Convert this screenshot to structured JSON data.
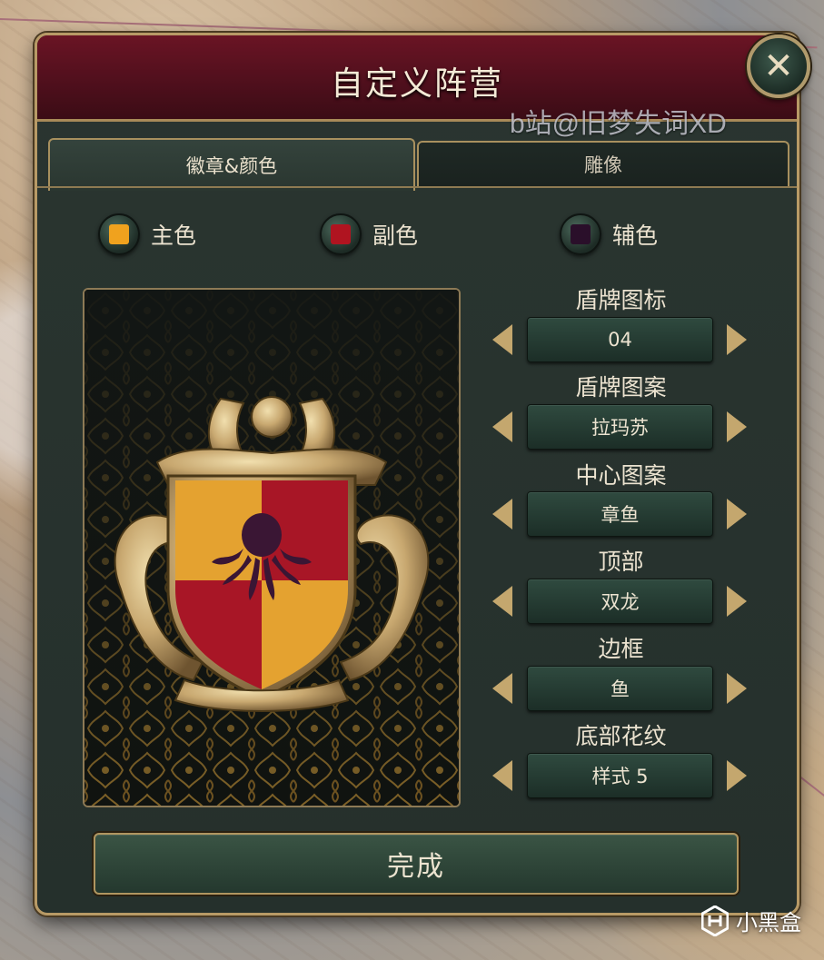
{
  "window": {
    "title": "自定义阵营",
    "close_symbol": "✕",
    "watermark": "b站@旧梦失词XD"
  },
  "tabs": [
    {
      "label": "徽章&颜色",
      "active": true
    },
    {
      "label": "雕像",
      "active": false
    }
  ],
  "colors": [
    {
      "label": "主色",
      "swatch": "#f0a21e"
    },
    {
      "label": "副色",
      "swatch": "#b01420"
    },
    {
      "label": "辅色",
      "swatch": "#2a0f2a"
    }
  ],
  "emblem": {
    "icon": "octopus-icon",
    "shield_colors": [
      "#e4a230",
      "#a81626"
    ],
    "sigil_color": "#3a1634"
  },
  "controls": [
    {
      "label": "盾牌图标",
      "value": "04"
    },
    {
      "label": "盾牌图案",
      "value": "拉玛苏"
    },
    {
      "label": "中心图案",
      "value": "章鱼"
    },
    {
      "label": "顶部",
      "value": "双龙"
    },
    {
      "label": "边框",
      "value": "鱼"
    },
    {
      "label": "底部花纹",
      "value": "样式 5"
    }
  ],
  "done_button": "完成",
  "branding": "小黑盒"
}
